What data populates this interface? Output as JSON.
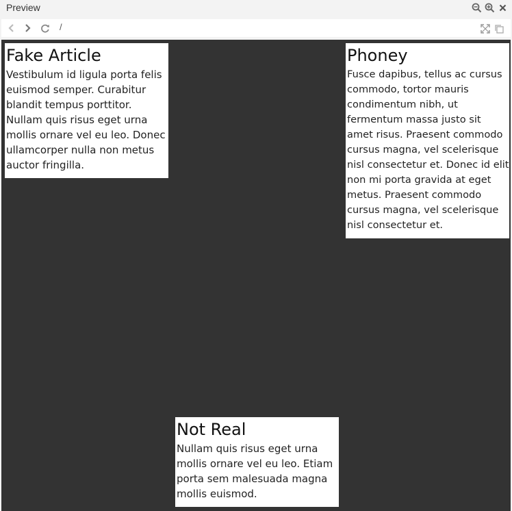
{
  "panel": {
    "title": "Preview",
    "icons": [
      "zoom-out-icon",
      "zoom-in-icon",
      "close-icon"
    ]
  },
  "toolbar": {
    "url": "/",
    "icons": [
      "back-arrow-icon",
      "forward-arrow-icon",
      "reload-icon",
      "fullscreen-icon",
      "popout-icon"
    ]
  },
  "colors": {
    "viewport_bg": "#333333",
    "card_bg": "#ffffff",
    "chrome_bg": "#f3f3f3"
  },
  "articles": [
    {
      "title": "Fake Article",
      "body": "Vestibulum id ligula porta felis euismod semper. Curabitur blandit tempus porttitor. Nullam quis risus eget urna mollis ornare vel eu leo. Donec ullamcorper nulla non metus auctor fringilla."
    },
    {
      "title": "Phoney",
      "body": "Fusce dapibus, tellus ac cursus commodo, tortor mauris condimentum nibh, ut fermentum massa justo sit amet risus. Praesent commodo cursus magna, vel scelerisque nisl consectetur et. Donec id elit non mi porta gravida at eget metus. Praesent commodo cursus magna, vel scelerisque nisl consectetur et."
    },
    {
      "title": "Not Real",
      "body": "Nullam quis risus eget urna mollis ornare vel eu leo. Etiam porta sem malesuada magna mollis euismod."
    }
  ]
}
